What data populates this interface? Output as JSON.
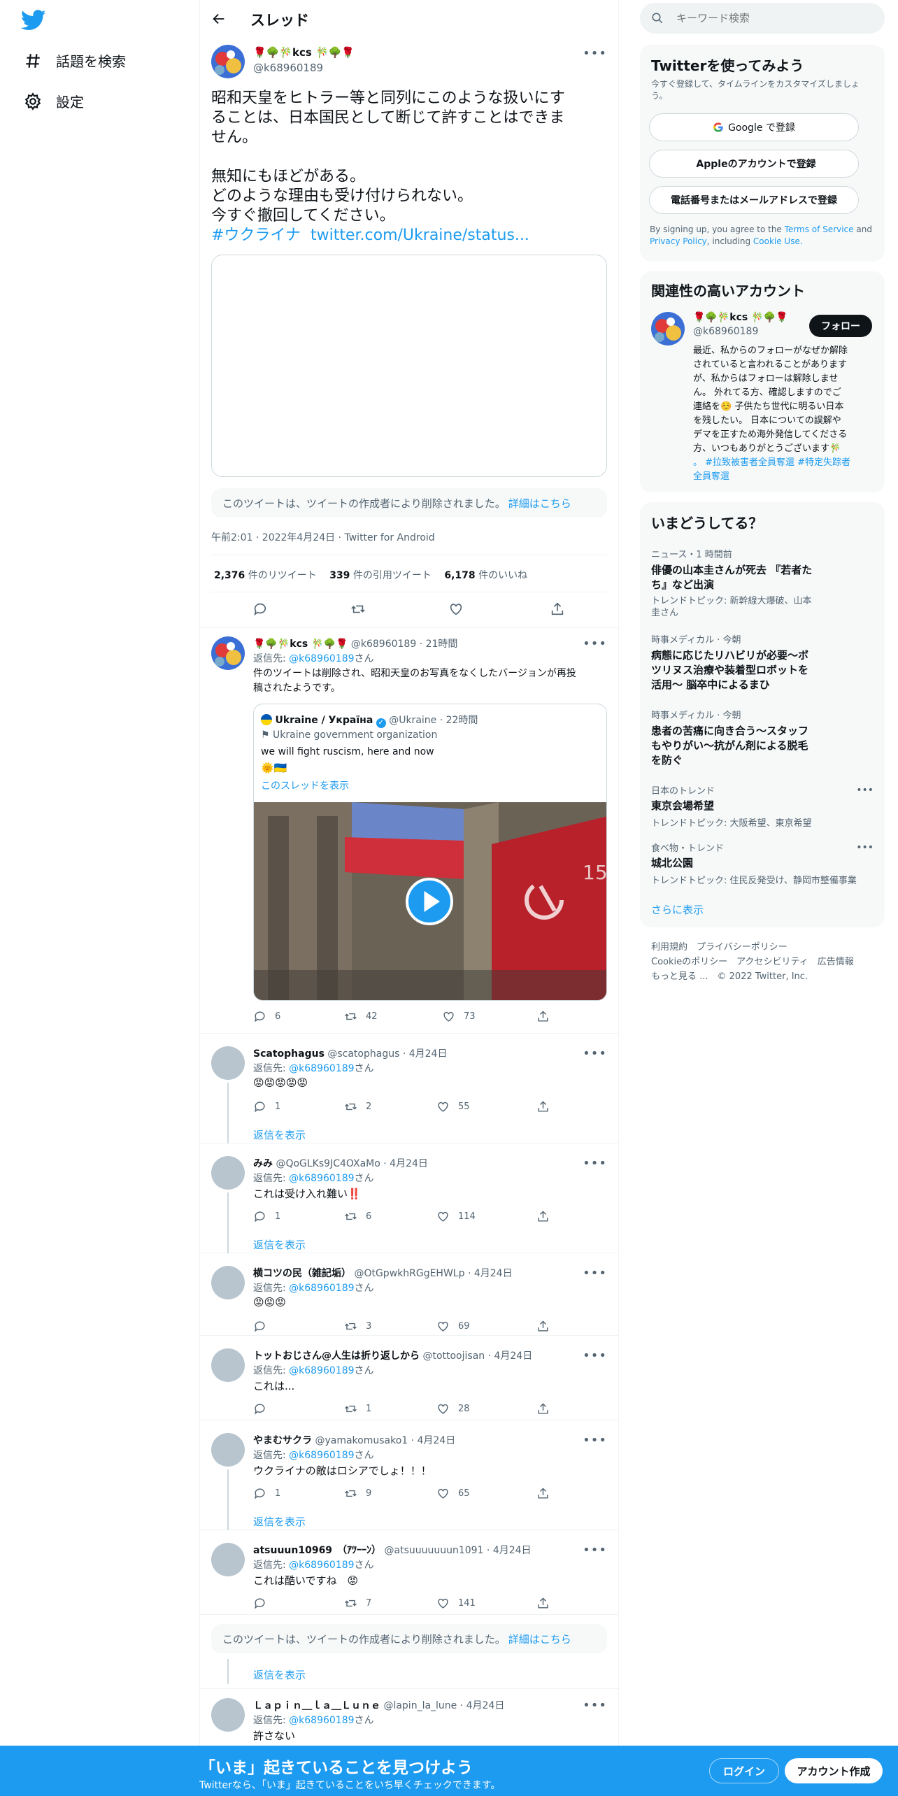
{
  "nav": {
    "explore": "話題を検索",
    "settings": "設定"
  },
  "header": {
    "title": "スレッド"
  },
  "main_tweet": {
    "name": "🌹🌳🎋kcs 🎋🌳🌹",
    "handle": "@k68960189",
    "text_lines": [
      "昭和天皇をヒトラー等と同列にこのような扱いにす",
      "ることは、日本国民として断じて許すことはできま",
      "せん。",
      "",
      "無知にもほどがある。",
      "どのような理由も受け付けられない。",
      "今すぐ撤回してください。"
    ],
    "hashtag": "#ウクライナ",
    "link": "twitter.com/Ukraine/status...",
    "deleted_notice": "このツイートは、ツイートの作成者により削除されました。",
    "learn_more": "詳細はこちら",
    "meta": "午前2:01 · 2022年4月24日 · Twitter for Android",
    "retweets_num": "2,376",
    "retweets_label": "件のリツイート",
    "quotes_num": "339",
    "quotes_label": "件の引用ツイート",
    "likes_num": "6,178",
    "likes_label": "件のいいね"
  },
  "self_reply": {
    "name": "🌹🌳🎋kcs 🎋🌳🌹",
    "handle": "@k68960189 · 21時間",
    "reply_to_label": "返信先:",
    "reply_to": "@k68960189",
    "reply_suffix": "さん",
    "text1": "件のツイートは削除され、昭和天皇のお写真をなくしたバージョンが再投",
    "text2": "稿されたようです。",
    "quoted": {
      "name": "Ukraine / Україна",
      "handle": "@Ukraine · 22時間",
      "org": "⚑ Ukraine government organization",
      "text": "we will fight ruscism, here and now",
      "emoji": "🌞🇺🇦",
      "show_thread": "このスレッドを表示"
    },
    "counts": {
      "reply": "6",
      "retweet": "42",
      "like": "73"
    }
  },
  "replies": [
    {
      "name": "Scatophagus",
      "handle": "@scatophagus · 4月24日",
      "text": "😡😡😡😡😡",
      "reply": "1",
      "retweet": "2",
      "like": "55",
      "show": "返信を表示"
    },
    {
      "name": "みみ",
      "handle": "@QoGLKs9JC4OXaMo · 4月24日",
      "text": "これは受け入れ難い‼️",
      "reply": "1",
      "retweet": "6",
      "like": "114",
      "show": "返信を表示"
    },
    {
      "name": "横コツの民（雑記垢）",
      "handle": "@OtGpwkhRGgEHWLp · 4月24日",
      "text": "😡😡😡",
      "reply": "",
      "retweet": "3",
      "like": "69",
      "show": ""
    },
    {
      "name": "トットおじさん@人生は折り返しから",
      "handle": "@tottoojisan · 4月24日",
      "text": "これは...",
      "reply": "",
      "retweet": "1",
      "like": "28",
      "show": ""
    },
    {
      "name": "やまむサクラ",
      "handle": "@yamakomusako1 · 4月24日",
      "text": "ウクライナの敵はロシアでしょ！！！",
      "reply": "1",
      "retweet": "9",
      "like": "65",
      "show": "返信を表示"
    },
    {
      "name": "atsuuun10969　（ｱﾂｰｰﾝ）",
      "handle": "@atsuuuuuuun1091 · 4月24日",
      "text": "これは酷いですね　😡",
      "reply": "",
      "retweet": "7",
      "like": "141",
      "show": ""
    }
  ],
  "deleted2": {
    "notice": "このツイートは、ツイートの作成者により削除されました。",
    "learn_more": "詳細はこちら",
    "show": "返信を表示"
  },
  "last_reply": {
    "name": "Ｌａｐｉｎ＿ｌａ＿Ｌｕｎｅ",
    "handle": "@lapin_la_lune · 4月24日",
    "text": "許さない"
  },
  "search": {
    "placeholder": "キーワード検索"
  },
  "signup": {
    "title": "Twitterを使ってみよう",
    "sub": "今すぐ登録して、タイムラインをカスタマイズしましょう。",
    "google": "Google で登録",
    "apple": "Appleのアカウントで登録",
    "phone": "電話番号またはメールアドレスで登録",
    "legal_a": "By signing up, you agree to the",
    "terms": "Terms of Service",
    "legal_and": "and",
    "privacy": "Privacy Policy",
    "legal_inc": ", including",
    "cookie": "Cookie Use."
  },
  "related": {
    "title": "関連性の高いアカウント",
    "name": "🌹🌳🎋kcs 🎋🌳🌹",
    "handle": "@k68960189",
    "follow": "フォロー",
    "bio_lines": [
      "最近、私からのフォローがなぜか解除",
      "されていると言われることがあります",
      "が、私からはフォローは解除しませ",
      "ん。 外れてる方、確認しますのでご",
      "連絡を☺️ 子供たち世代に明るい日本",
      "を残したい。 日本についての誤解や",
      "デマを正すため海外発信してくださる",
      "方、いつもありがとうございます🎋"
    ],
    "bio_tags1": "。 #拉致被害者全員奪還 #特定失踪者",
    "bio_tags2": "全員奪還"
  },
  "trends": {
    "title": "いまどうしてる？",
    "items": [
      {
        "cat": "ニュース・1 時間前",
        "title1": "俳優の山本圭さんが死去 『若者た",
        "title2": "ち』など出演",
        "sub1": "トレンドトピック: 新幹線大爆破、山本",
        "sub2": "圭さん"
      },
      {
        "cat": "時事メディカル · 今朝",
        "title1": "病態に応じたリハビリが必要～ボ",
        "title2": "ツリヌス治療や装着型ロボットを",
        "title3": "活用～ 脳卒中によるまひ"
      },
      {
        "cat": "時事メディカル · 今朝",
        "title1": "患者の苦痛に向き合う～スタッフ",
        "title2": "もやりがい～抗がん剤による脱毛",
        "title3": "を防ぐ"
      },
      {
        "cat": "日本のトレンド",
        "title1": "東京会場希望",
        "sub1": "トレンドトピック: 大阪希望、東京希望"
      },
      {
        "cat": "食べ物・トレンド",
        "title1": "城北公園",
        "sub1": "トレンドトピック: 住民反発受け、静岡市整備事業"
      }
    ],
    "more": "さらに表示"
  },
  "footer": {
    "row1": "利用規約　プライバシーポリシー",
    "row2": "Cookieのポリシー　アクセシビリティ　広告情報",
    "row3": "もっと見る ...　© 2022 Twitter, Inc."
  },
  "bottom": {
    "title": "「いま」起きていることを見つけよう",
    "sub": "Twitterなら、「いま」起きていることをいち早くチェックできます。",
    "login": "ログイン",
    "signup": "アカウント作成"
  },
  "colors": {
    "accent": "#1d9bf0",
    "text": "#0f1419",
    "muted": "#536471"
  }
}
